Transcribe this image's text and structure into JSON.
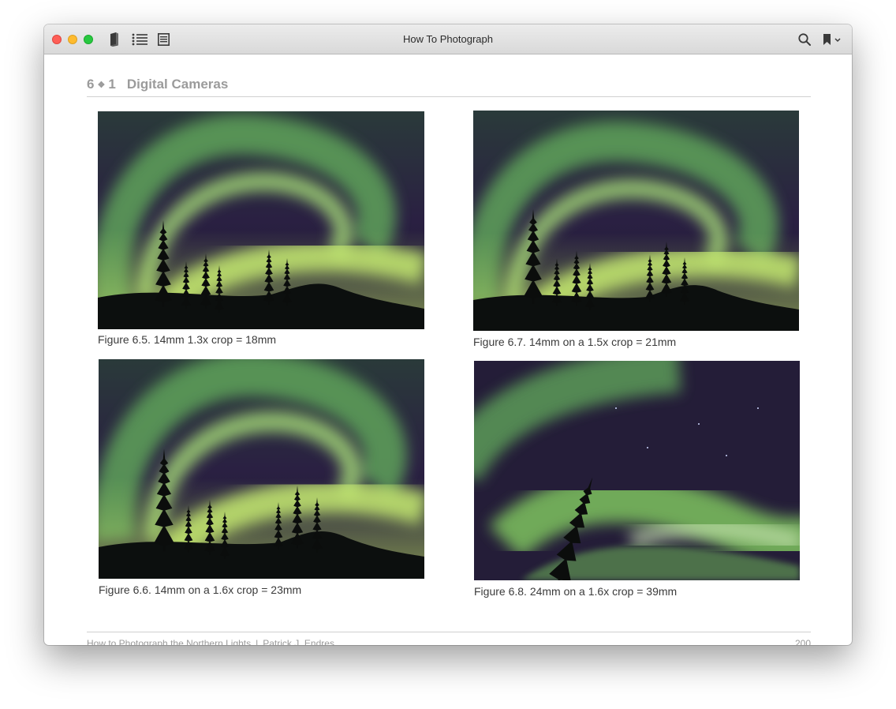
{
  "window": {
    "title": "How To Photograph"
  },
  "toolbar": {
    "library_icon": "book-icon",
    "toc_icon": "list-icon",
    "notes_icon": "notes-icon",
    "search_icon": "search-icon",
    "bookmark_icon": "bookmark-icon"
  },
  "page": {
    "chapter_number": "6",
    "chapter_separator": "❖",
    "section_number": "1",
    "section_title": "Digital Cameras",
    "figures": [
      {
        "caption": "Figure 6.5. 14mm 1.3x crop = 18mm"
      },
      {
        "caption": "Figure 6.7. 14mm on a 1.5x crop = 21mm"
      },
      {
        "caption": "Figure 6.6. 14mm on a 1.6x crop = 23mm"
      },
      {
        "caption": "Figure 6.8. 24mm on a 1.6x crop = 39mm"
      }
    ]
  },
  "footer": {
    "book_title": "How to Photograph the Northern Lights",
    "separator": "|",
    "author": "Patrick J. Endres",
    "page_number": "200"
  },
  "colors": {
    "aurora_green": "#7ed35a",
    "night_sky": "#1e1a32",
    "heading_gray": "#9b9b9b"
  }
}
